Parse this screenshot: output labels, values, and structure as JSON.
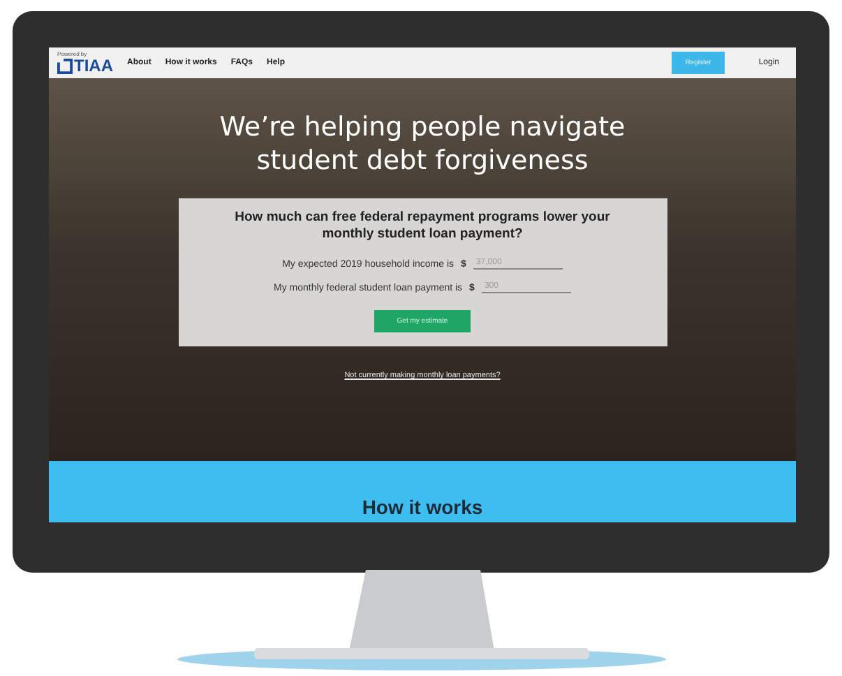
{
  "nav": {
    "powered_by": "Powered by",
    "logo": "TIAA",
    "links": [
      {
        "label": "About"
      },
      {
        "label": "How it works"
      },
      {
        "label": "FAQs"
      },
      {
        "label": "Help"
      }
    ],
    "register": "Register",
    "login": "Login"
  },
  "hero": {
    "headline_lines": [
      "We’re helping people navigate",
      "student debt forgiveness"
    ],
    "card": {
      "question": "How much can free federal repayment programs lower your monthly student loan payment?",
      "fields": [
        {
          "label": "My expected 2019 household income is",
          "currency": "$",
          "placeholder": "37,000"
        },
        {
          "label": "My monthly federal student loan payment is",
          "currency": "$",
          "placeholder": "300"
        }
      ],
      "button": "Get my estimate"
    },
    "link": "Not currently making monthly loan payments?"
  },
  "section": {
    "title": "How it works"
  }
}
